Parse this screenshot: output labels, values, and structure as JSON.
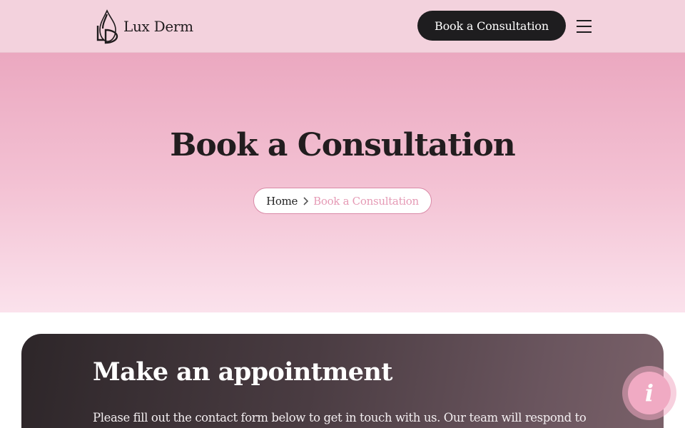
{
  "header": {
    "logo_text": "Lux Derm",
    "cta_label": "Book a Consultation",
    "menu_icon": "hamburger-icon"
  },
  "hero": {
    "title": "Book a Consultation",
    "breadcrumb": {
      "home": "Home",
      "current": "Book a Consultation",
      "separator_icon": "chevron-right-icon"
    }
  },
  "appointment": {
    "title": "Make an appointment",
    "intro": "Please fill out the contact form below to get in touch with us. Our team will respond to"
  },
  "info_button": {
    "glyph": "i",
    "icon": "info-icon"
  },
  "colors": {
    "brand_pink": "#eba8c0",
    "header_bg": "#f3d2dd",
    "dark": "#1e1d1f",
    "breadcrumb_current": "#e59ab5"
  }
}
